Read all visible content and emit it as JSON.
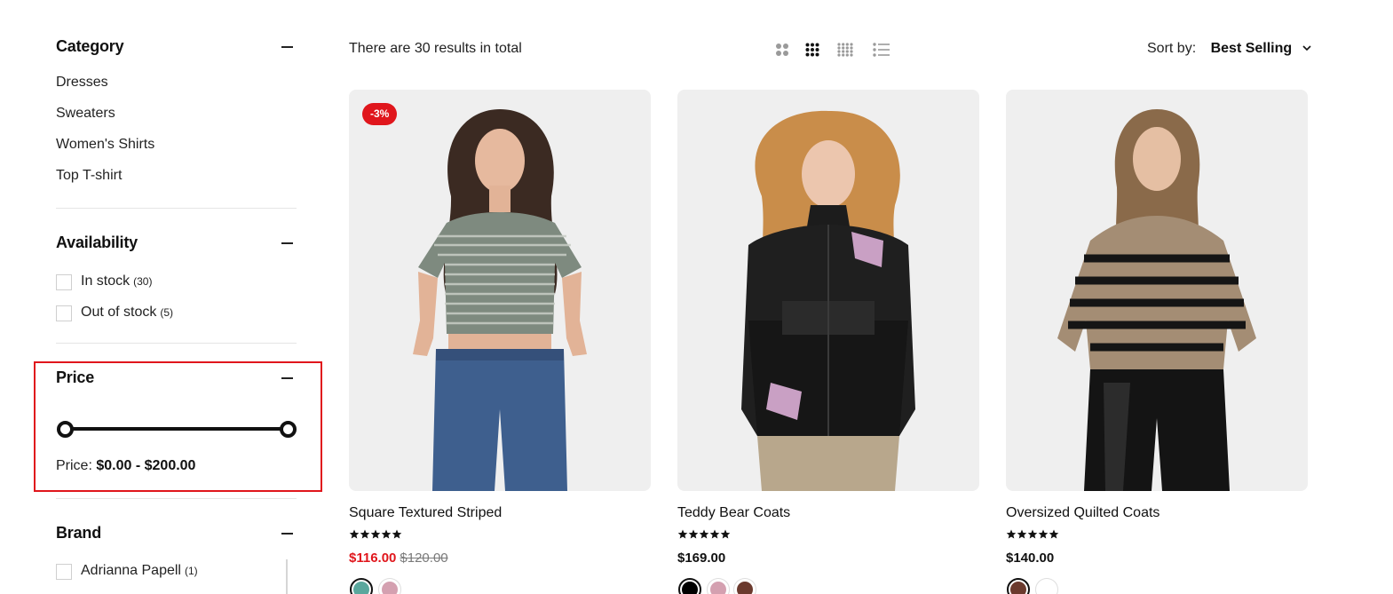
{
  "sidebar": {
    "category": {
      "title": "Category",
      "items": [
        "Dresses",
        "Sweaters",
        "Women's Shirts",
        "Top T-shirt"
      ]
    },
    "availability": {
      "title": "Availability",
      "options": [
        {
          "label": "In stock",
          "count": "(30)",
          "checked": false
        },
        {
          "label": "Out of stock",
          "count": "(5)",
          "checked": false
        }
      ]
    },
    "price": {
      "title": "Price",
      "label": "Price:",
      "range_text": "$0.00 - $200.00",
      "min": 0,
      "max": 200,
      "low": 0,
      "high": 200
    },
    "brand": {
      "title": "Brand",
      "options": [
        {
          "label": "Adrianna Papell",
          "count": "(1)",
          "checked": false
        }
      ]
    }
  },
  "toolbar": {
    "results_text": "There are 30 results in total",
    "views": [
      {
        "icon": "grid-2-icon",
        "active": false
      },
      {
        "icon": "grid-3-icon",
        "active": true
      },
      {
        "icon": "grid-4-icon",
        "active": false
      },
      {
        "icon": "list-view-icon",
        "active": false
      }
    ],
    "sort_label": "Sort by:",
    "sort_value": "Best Selling"
  },
  "products": [
    {
      "title": "Square Textured Striped",
      "badge": "-3%",
      "rating": 5,
      "price": "$116.00",
      "compare_price": "$120.00",
      "on_sale": true,
      "swatches": [
        {
          "color": "#5aa79d",
          "selected": true
        },
        {
          "color": "#d4a0b0",
          "selected": false
        }
      ]
    },
    {
      "title": "Teddy Bear Coats",
      "badge": "",
      "rating": 5,
      "price": "$169.00",
      "compare_price": "",
      "on_sale": false,
      "swatches": [
        {
          "color": "#000000",
          "selected": true
        },
        {
          "color": "#d4a0b0",
          "selected": false
        },
        {
          "color": "#6b3a2e",
          "selected": false
        }
      ]
    },
    {
      "title": "Oversized Quilted Coats",
      "badge": "",
      "rating": 5,
      "price": "$140.00",
      "compare_price": "",
      "on_sale": false,
      "swatches": [
        {
          "color": "#6b3a2e",
          "selected": true
        },
        {
          "color": "#ffffff",
          "selected": false
        }
      ]
    }
  ],
  "colors": {
    "accent": "#e0161c",
    "text": "#111111",
    "image_bg": "#efefef"
  }
}
